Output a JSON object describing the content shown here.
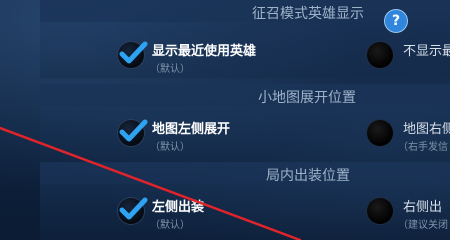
{
  "sections": [
    {
      "title": "征召模式英雄显示",
      "left_option": {
        "label": "显示最近使用英雄",
        "sub": "（默认）"
      },
      "right_option": {
        "label": "不显示最",
        "sub": ""
      }
    },
    {
      "title": "小地图展开位置",
      "left_option": {
        "label": "地图左侧展开",
        "sub": "（默认）"
      },
      "right_option": {
        "label": "地图右侧",
        "sub": "（右手发信"
      }
    },
    {
      "title": "局内出装位置",
      "left_option": {
        "label": "左侧出装",
        "sub": "（默认）"
      },
      "right_option": {
        "label": "右侧出",
        "sub": "（建议关闭"
      }
    }
  ],
  "help_icon_glyph": "?",
  "colors": {
    "accent_blue": "#2f86dc",
    "check_blue": "#2ea3f2",
    "annotation_red": "#e0242a"
  }
}
